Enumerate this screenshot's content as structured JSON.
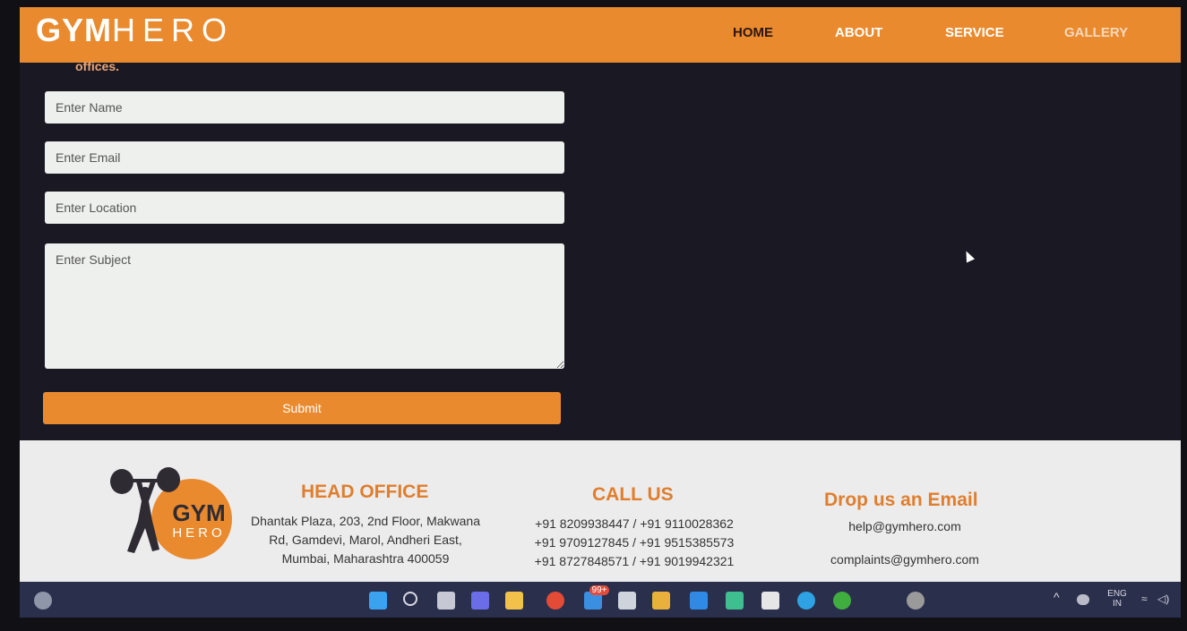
{
  "header": {
    "brand_bold": "GYM",
    "brand_light": "HERO",
    "nav": [
      {
        "label": "HOME",
        "active": true
      },
      {
        "label": "ABOUT",
        "active": false
      },
      {
        "label": "SERVICE",
        "active": false
      },
      {
        "label": "GALLERY",
        "active": false
      }
    ]
  },
  "intro_text": "offices.",
  "form": {
    "name_placeholder": "Enter Name",
    "email_placeholder": "Enter Email",
    "location_placeholder": "Enter Location",
    "subject_placeholder": "Enter Subject",
    "submit_label": "Submit"
  },
  "footer": {
    "logo_gym": "GYM",
    "logo_hero": "HERO",
    "head_office": {
      "title": "HEAD OFFICE",
      "lines": [
        "Dhantak Plaza, 203, 2nd Floor, Makwana",
        "Rd, Gamdevi, Marol, Andheri East,",
        "Mumbai, Maharashtra 400059"
      ]
    },
    "call_us": {
      "title": "CALL US",
      "lines": [
        "+91 8209938447 / +91 9110028362",
        "+91 9709127845 / +91 9515385573",
        "+91 8727848571 / +91 9019942321"
      ]
    },
    "email": {
      "title": "Drop us an Email",
      "lines": [
        "help@gymhero.com",
        "complaints@gymhero.com"
      ]
    }
  },
  "taskbar": {
    "icons": [
      "weather-icon",
      "windows-start-icon",
      "search-icon",
      "task-view-icon",
      "chat-icon",
      "file-explorer-icon",
      "chrome-icon",
      "mail-icon",
      "calendar-icon",
      "app-icon",
      "vscode-icon",
      "app-icon-2",
      "notion-icon",
      "telegram-icon",
      "app-icon-3",
      "settings-icon"
    ],
    "mail_badge": "99+",
    "lang_line1": "ENG",
    "lang_line2": "IN"
  },
  "colors": {
    "accent": "#ea8a2e",
    "dark_bg": "#1a1822",
    "footer_bg": "#ececec"
  }
}
